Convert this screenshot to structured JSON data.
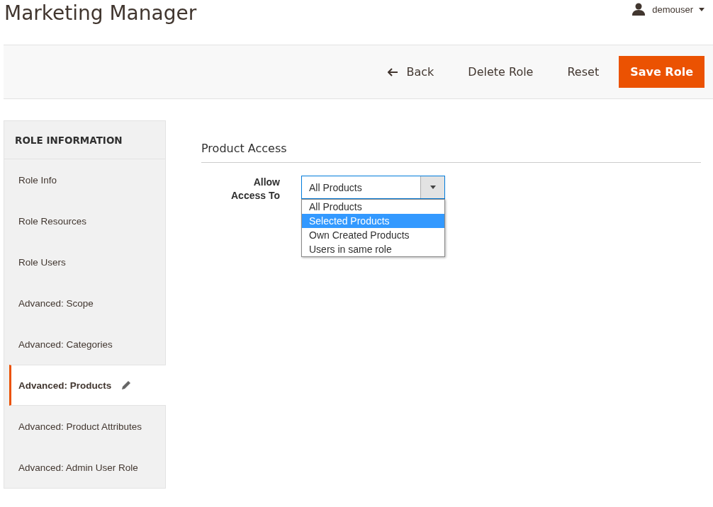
{
  "page_title": "Marketing Manager",
  "user": {
    "name": "demouser"
  },
  "actions": [
    {
      "label": "Back",
      "kind": "back"
    },
    {
      "label": "Delete Role",
      "kind": "plain"
    },
    {
      "label": "Reset",
      "kind": "plain"
    },
    {
      "label": "Save Role",
      "kind": "primary"
    }
  ],
  "sidebar": {
    "title": "ROLE INFORMATION",
    "items": [
      {
        "label": "Role Info",
        "selected": false
      },
      {
        "label": "Role Resources",
        "selected": false
      },
      {
        "label": "Role Users",
        "selected": false
      },
      {
        "label": "Advanced: Scope",
        "selected": false
      },
      {
        "label": "Advanced: Categories",
        "selected": false
      },
      {
        "label": "Advanced: Products",
        "selected": true
      },
      {
        "label": "Advanced: Product Attributes",
        "selected": false
      },
      {
        "label": "Advanced: Admin User Role",
        "selected": false
      }
    ]
  },
  "section": {
    "title": "Product Access",
    "field": {
      "label_lines": [
        "Allow",
        "Access To"
      ],
      "value": "All Products",
      "expanded": true,
      "options": [
        {
          "label": "All Products",
          "highlighted": false
        },
        {
          "label": "Selected Products",
          "highlighted": true
        },
        {
          "label": "Own Created Products",
          "highlighted": false
        },
        {
          "label": "Users in same role",
          "highlighted": false
        }
      ]
    }
  }
}
